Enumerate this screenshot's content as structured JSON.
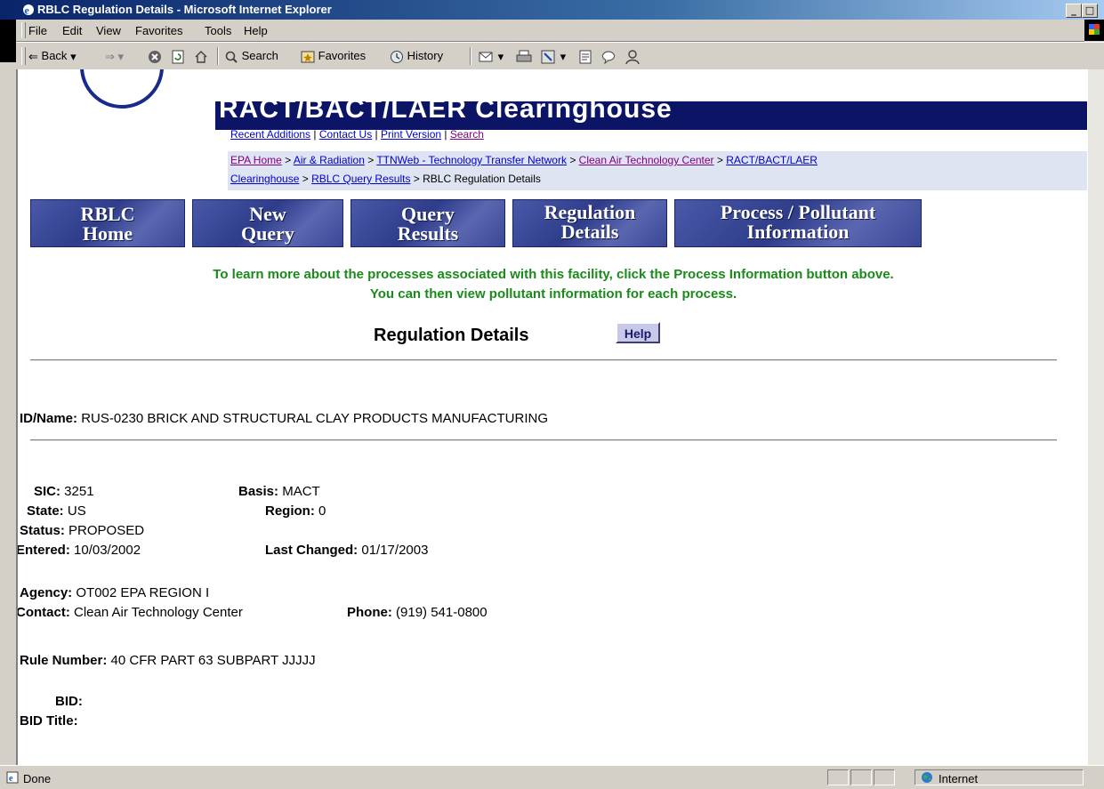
{
  "window": {
    "title": "RBLC Regulation Details - Microsoft Internet Explorer",
    "min": "_",
    "max": "□"
  },
  "menu": [
    "File",
    "Edit",
    "View",
    "Favorites",
    "Tools",
    "Help"
  ],
  "toolbar": {
    "back": "Back",
    "search": "Search",
    "favorites": "Favorites",
    "history": "History"
  },
  "banner": {
    "text": "RACT/BACT/LAER Clearinghouse"
  },
  "toplinks": {
    "recent": "Recent Additions",
    "contact": "Contact Us",
    "print": "Print Version",
    "search": "Search",
    "sep": " | "
  },
  "breadcrumb": {
    "epa_home": "EPA Home",
    "air": "Air & Radiation",
    "ttn": "TTNWeb - Technology Transfer Network",
    "catc": "Clean Air Technology Center",
    "ract": "RACT/BACT/LAER",
    "clearinghouse": "Clearinghouse",
    "query_results": "RBLC Query Results",
    "current": "RBLC Regulation Details",
    "sep": " > "
  },
  "nav": {
    "home": [
      "RBLC",
      "Home"
    ],
    "new_query": [
      "New",
      "Query"
    ],
    "query_results": [
      "Query",
      "Results"
    ],
    "reg_details": [
      "Regulation",
      "Details"
    ],
    "process": [
      "Process / Pollutant",
      "Information"
    ]
  },
  "note": {
    "line1": "To learn more about the processes associated with this facility, click the Process Information button above.",
    "line2": "You can then view pollutant information for each process."
  },
  "heading": "Regulation Details",
  "help": "Help",
  "fields": {
    "id_label": "ID/Name:",
    "id_value": "RUS-0230 BRICK AND STRUCTURAL CLAY PRODUCTS MANUFACTURING",
    "sic_label": "SIC:",
    "sic_value": "3251",
    "basis_label": "Basis:",
    "basis_value": "MACT",
    "state_label": "State:",
    "state_value": "US",
    "region_label": "Region:",
    "region_value": "0",
    "status_label": "Status:",
    "status_value": "PROPOSED",
    "entered_label": "Entered:",
    "entered_value": "10/03/2002",
    "changed_label": "Last Changed:",
    "changed_value": "01/17/2003",
    "agency_label": "Agency:",
    "agency_value": "OT002 EPA REGION I",
    "contact_label": "Contact:",
    "contact_value": "Clean Air Technology Center",
    "phone_label": "Phone:",
    "phone_value": "(919) 541-0800",
    "rule_label": "Rule Number:",
    "rule_value": "40 CFR PART 63 SUBPART JJJJJ",
    "bid_label": "BID:",
    "bid_title_label": "BID Title:"
  },
  "status": {
    "text": "Done",
    "zone": "Internet"
  }
}
